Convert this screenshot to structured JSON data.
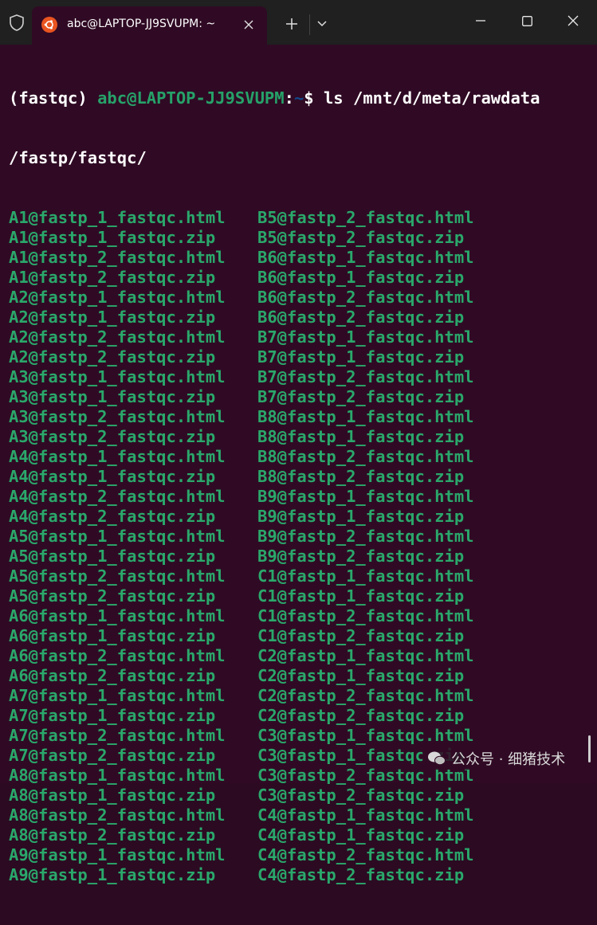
{
  "titlebar": {
    "tab_title": "abc@LAPTOP-JJ9SVUPM: ~"
  },
  "terminal": {
    "prompt": {
      "env": "(fastqc) ",
      "userhost": "abc@LAPTOP-JJ9SVUPM",
      "colon": ":",
      "path": "~",
      "dollar": "$ ",
      "command": "ls /mnt/d/meta/rawdata",
      "command_wrap": "/fastp/fastqc/"
    },
    "files_col1": [
      "A1@fastp_1_fastqc.html",
      "A1@fastp_1_fastqc.zip",
      "A1@fastp_2_fastqc.html",
      "A1@fastp_2_fastqc.zip",
      "A2@fastp_1_fastqc.html",
      "A2@fastp_1_fastqc.zip",
      "A2@fastp_2_fastqc.html",
      "A2@fastp_2_fastqc.zip",
      "A3@fastp_1_fastqc.html",
      "A3@fastp_1_fastqc.zip",
      "A3@fastp_2_fastqc.html",
      "A3@fastp_2_fastqc.zip",
      "A4@fastp_1_fastqc.html",
      "A4@fastp_1_fastqc.zip",
      "A4@fastp_2_fastqc.html",
      "A4@fastp_2_fastqc.zip",
      "A5@fastp_1_fastqc.html",
      "A5@fastp_1_fastqc.zip",
      "A5@fastp_2_fastqc.html",
      "A5@fastp_2_fastqc.zip",
      "A6@fastp_1_fastqc.html",
      "A6@fastp_1_fastqc.zip",
      "A6@fastp_2_fastqc.html",
      "A6@fastp_2_fastqc.zip",
      "A7@fastp_1_fastqc.html",
      "A7@fastp_1_fastqc.zip",
      "A7@fastp_2_fastqc.html",
      "A7@fastp_2_fastqc.zip",
      "A8@fastp_1_fastqc.html",
      "A8@fastp_1_fastqc.zip",
      "A8@fastp_2_fastqc.html",
      "A8@fastp_2_fastqc.zip",
      "A9@fastp_1_fastqc.html",
      "A9@fastp_1_fastqc.zip"
    ],
    "files_col2": [
      "B5@fastp_2_fastqc.html",
      "B5@fastp_2_fastqc.zip",
      "B6@fastp_1_fastqc.html",
      "B6@fastp_1_fastqc.zip",
      "B6@fastp_2_fastqc.html",
      "B6@fastp_2_fastqc.zip",
      "B7@fastp_1_fastqc.html",
      "B7@fastp_1_fastqc.zip",
      "B7@fastp_2_fastqc.html",
      "B7@fastp_2_fastqc.zip",
      "B8@fastp_1_fastqc.html",
      "B8@fastp_1_fastqc.zip",
      "B8@fastp_2_fastqc.html",
      "B8@fastp_2_fastqc.zip",
      "B9@fastp_1_fastqc.html",
      "B9@fastp_1_fastqc.zip",
      "B9@fastp_2_fastqc.html",
      "B9@fastp_2_fastqc.zip",
      "C1@fastp_1_fastqc.html",
      "C1@fastp_1_fastqc.zip",
      "C1@fastp_2_fastqc.html",
      "C1@fastp_2_fastqc.zip",
      "C2@fastp_1_fastqc.html",
      "C2@fastp_1_fastqc.zip",
      "C2@fastp_2_fastqc.html",
      "C2@fastp_2_fastqc.zip",
      "C3@fastp_1_fastqc.html",
      "C3@fastp_1_fastqc.zip",
      "C3@fastp_2_fastqc.html",
      "C3@fastp_2_fastqc.zip",
      "C4@fastp_1_fastqc.html",
      "C4@fastp_1_fastqc.zip",
      "C4@fastp_2_fastqc.html",
      "C4@fastp_2_fastqc.zip"
    ]
  },
  "watermark": {
    "text": "公众号 · 细猪技术"
  },
  "icons": {
    "shield": "shield-icon",
    "ubuntu": "ubuntu-icon",
    "close_tab": "close-icon",
    "new_tab": "plus-icon",
    "dropdown": "chevron-down-icon",
    "minimize": "minimize-icon",
    "maximize": "maximize-icon",
    "close_window": "close-icon",
    "wechat": "wechat-icon"
  },
  "colors": {
    "background": "#300a24",
    "titlebar": "#202020",
    "userhost": "#26a269",
    "path": "#12488b",
    "filename": "#2aa86b",
    "ubuntu_orange": "#e95420"
  }
}
